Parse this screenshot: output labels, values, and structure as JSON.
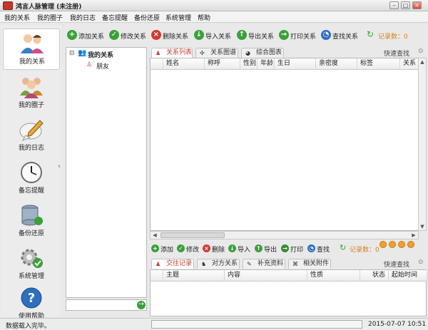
{
  "window": {
    "title": "鸿言人脉管理 (未注册)",
    "min": "–",
    "max": "□",
    "close": "×"
  },
  "menu": [
    "我的关系",
    "我的圈子",
    "我的日志",
    "备忘提醒",
    "备份还原",
    "系统管理",
    "帮助"
  ],
  "sidebar": [
    {
      "label": "我的关系",
      "icon": "people-icon",
      "active": true
    },
    {
      "label": "我的圈子",
      "icon": "group-icon",
      "active": false
    },
    {
      "label": "我的日志",
      "icon": "pencil-bubble-icon",
      "active": false
    },
    {
      "label": "备忘提醒",
      "icon": "clock-icon",
      "active": false
    },
    {
      "label": "备份还原",
      "icon": "database-icon",
      "active": false
    },
    {
      "label": "系统管理",
      "icon": "gear-icon",
      "active": false
    },
    {
      "label": "使用帮助",
      "icon": "help-icon",
      "active": false
    }
  ],
  "toolbar": {
    "add": "添加关系",
    "edit": "修改关系",
    "delete": "删除关系",
    "import": "导入关系",
    "export": "导出关系",
    "print": "打印关系",
    "find": "查找关系",
    "refresh_icon": "↻",
    "count_label": "记录数：0"
  },
  "tree": {
    "root": "我的关系",
    "child": "朋友",
    "expander": "⊟"
  },
  "tabs1": [
    {
      "label": "关系列表",
      "icon": "person-icon",
      "active": true
    },
    {
      "label": "关系图谱",
      "icon": "graph-icon",
      "active": false
    },
    {
      "label": "综合图表",
      "icon": "chart-icon",
      "active": false
    }
  ],
  "quick_find": "快速查找",
  "grid1": {
    "headers": [
      "姓名",
      "称呼",
      "性别",
      "年龄",
      "生日",
      "亲密度",
      "标签",
      "关系"
    ]
  },
  "toolbar2": {
    "add": "添加",
    "edit": "修改",
    "delete": "删除",
    "import": "导入",
    "export": "导出",
    "print": "打印",
    "find": "查找",
    "count_label": "记录数：0"
  },
  "tabs2": [
    {
      "label": "交往记录",
      "icon": "person-icon",
      "active": true
    },
    {
      "label": "对方关系",
      "icon": "people-icon",
      "active": false
    },
    {
      "label": "补充资料",
      "icon": "note-icon",
      "active": false
    },
    {
      "label": "相关附件",
      "icon": "paperclip-icon",
      "active": false
    }
  ],
  "grid2": {
    "headers": [
      "主题",
      "内容",
      "性质",
      "状态",
      "起始时间"
    ]
  },
  "status": {
    "text": "数据载入完毕。",
    "datetime": "2015-07-07 10:51"
  },
  "colors": {
    "accent_red": "#c0392b",
    "count_orange": "#d4821a",
    "green": "#3aa13a"
  }
}
